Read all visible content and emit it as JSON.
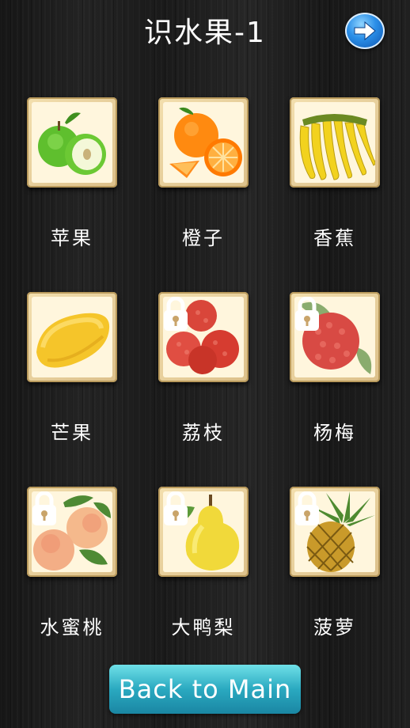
{
  "header": {
    "title": "识水果-1",
    "next_icon": "right-arrow-icon"
  },
  "fruits": [
    {
      "label": "苹果",
      "icon": "apple-image",
      "locked": false
    },
    {
      "label": "橙子",
      "icon": "orange-image",
      "locked": false
    },
    {
      "label": "香蕉",
      "icon": "banana-image",
      "locked": false
    },
    {
      "label": "芒果",
      "icon": "mango-image",
      "locked": false
    },
    {
      "label": "荔枝",
      "icon": "lychee-image",
      "locked": true
    },
    {
      "label": "杨梅",
      "icon": "bayberry-image",
      "locked": true
    },
    {
      "label": "水蜜桃",
      "icon": "peach-image",
      "locked": true
    },
    {
      "label": "大鸭梨",
      "icon": "pear-image",
      "locked": true
    },
    {
      "label": "菠萝",
      "icon": "pineapple-image",
      "locked": true
    }
  ],
  "footer": {
    "back_label": "Back to Main"
  },
  "colors": {
    "accent": "#2aa9c0",
    "tile": "#e8cf98",
    "lock": "#ffffff"
  }
}
